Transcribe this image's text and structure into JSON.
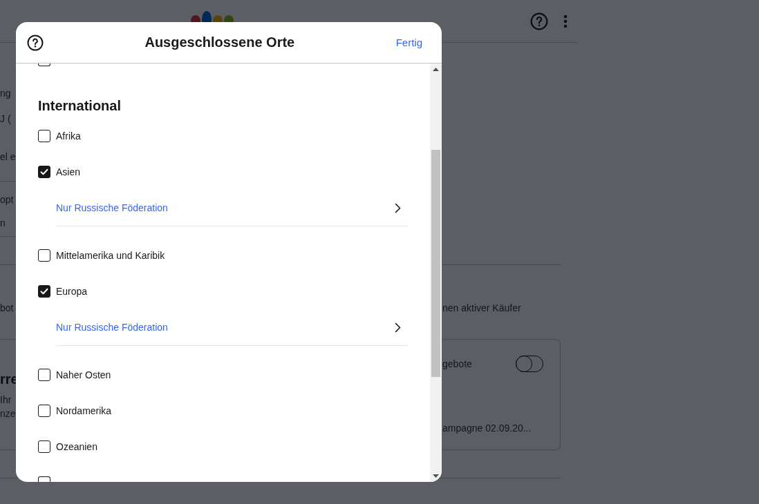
{
  "background_page": {
    "left_texts": [
      "ng",
      "J (",
      "el e",
      "opt",
      "n",
      "bot"
    ],
    "right_text": "nen aktiver Käufer",
    "card": {
      "heading": "rre",
      "lines": [
        "Ihr",
        "nze"
      ],
      "title": "gebote",
      "toggle": {
        "on": false
      },
      "footer": "ampagne 02.09.20..."
    }
  },
  "dialog": {
    "title": "Ausgeschlossene Orte",
    "done": "Fertig",
    "top_partial_checkbox": {
      "checked": false
    },
    "bottom_partial_checkbox": {
      "checked": false
    },
    "section": "International",
    "items": [
      {
        "label": "Afrika",
        "checked": false
      },
      {
        "label": "Asien",
        "checked": true,
        "sub_link": "Nur Russische Föderation"
      },
      {
        "label": "Mittelamerika und Karibik",
        "checked": false
      },
      {
        "label": "Europa",
        "checked": true,
        "sub_link": "Nur Russische Föderation"
      },
      {
        "label": "Naher Osten",
        "checked": false
      },
      {
        "label": "Nordamerika",
        "checked": false
      },
      {
        "label": "Ozeanien",
        "checked": false
      }
    ]
  }
}
